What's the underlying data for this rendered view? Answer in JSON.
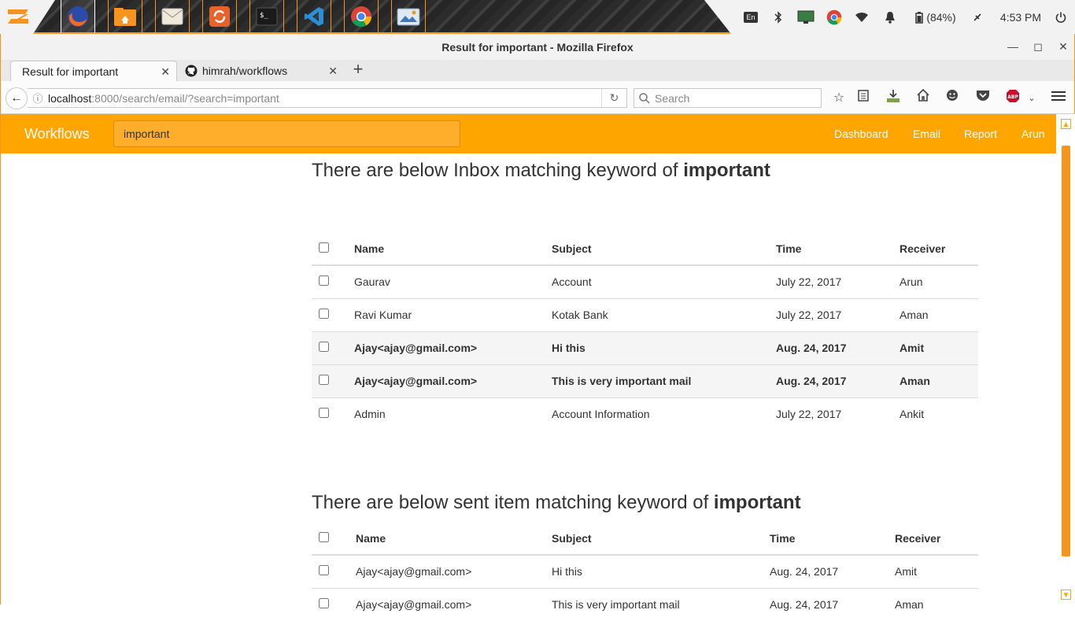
{
  "taskbar": {
    "battery": "(84%)",
    "clock": "4:53 PM",
    "keyboard_layout": "En",
    "dock_icons": [
      "firefox-icon",
      "files-icon",
      "mail-icon",
      "sync-icon",
      "terminal-icon",
      "vscode-icon",
      "chrome-icon",
      "image-viewer-icon"
    ]
  },
  "window": {
    "title": "Result for important - Mozilla Firefox"
  },
  "tabs": [
    {
      "label": "Result for important",
      "active": true
    },
    {
      "label": "himrah/workflows",
      "active": false
    }
  ],
  "urlbar": {
    "host": "localhost",
    "rest": ":8000/search/email/?search=important"
  },
  "searchbar": {
    "placeholder": "Search"
  },
  "app": {
    "brand": "Workflows",
    "search_value": "important",
    "nav": [
      "Dashboard",
      "Email",
      "Report",
      "Arun"
    ]
  },
  "inbox_section": {
    "heading_prefix": "There are below Inbox matching keyword of ",
    "keyword": "important",
    "columns": [
      "Name",
      "Subject",
      "Time",
      "Receiver"
    ],
    "rows": [
      {
        "name": "Gaurav",
        "subject": "Account",
        "time": "July 22, 2017",
        "receiver": "Arun",
        "unread": false
      },
      {
        "name": "Ravi Kumar",
        "subject": "Kotak Bank",
        "time": "July 22, 2017",
        "receiver": "Aman",
        "unread": false
      },
      {
        "name": "Ajay<ajay@gmail.com>",
        "subject": "Hi this",
        "time": "Aug. 24, 2017",
        "receiver": "Amit",
        "unread": true
      },
      {
        "name": "Ajay<ajay@gmail.com>",
        "subject": "This is very important mail",
        "time": "Aug. 24, 2017",
        "receiver": "Aman",
        "unread": true
      },
      {
        "name": "Admin",
        "subject": "Account Information",
        "time": "July 22, 2017",
        "receiver": "Ankit",
        "unread": false
      }
    ]
  },
  "sent_section": {
    "heading_prefix": "There are below sent item matching keyword of ",
    "keyword": "important",
    "columns": [
      "Name",
      "Subject",
      "Time",
      "Receiver"
    ],
    "rows": [
      {
        "name": "Ajay<ajay@gmail.com>",
        "subject": "Hi this",
        "time": "Aug. 24, 2017",
        "receiver": "Amit",
        "unread": false
      },
      {
        "name": "Ajay<ajay@gmail.com>",
        "subject": "This is very important mail",
        "time": "Aug. 24, 2017",
        "receiver": "Aman",
        "unread": false
      }
    ]
  },
  "colors": {
    "accent": "#ffa500",
    "taskbar_accent": "#f7941d"
  }
}
